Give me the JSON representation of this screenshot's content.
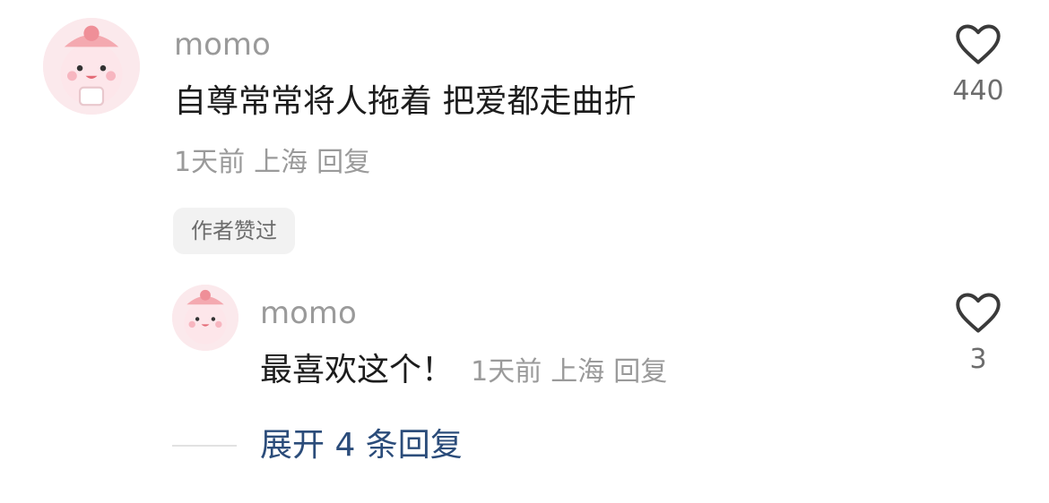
{
  "comment": {
    "username": "momo",
    "text": "自尊常常将人拖着 把爱都走曲折",
    "time": "1天前",
    "location": "上海",
    "reply_label": "回复",
    "badge": "作者赞过",
    "likes": "440"
  },
  "reply": {
    "username": "momo",
    "text": "最喜欢这个！",
    "time": "1天前",
    "location": "上海",
    "reply_label": "回复",
    "likes": "3"
  },
  "expand": {
    "label": "展开 4 条回复"
  },
  "icons": {
    "like": "heart-outline-icon"
  },
  "colors": {
    "expand_link": "#2b4c7a",
    "avatar_bg": "#fbe9ec"
  }
}
